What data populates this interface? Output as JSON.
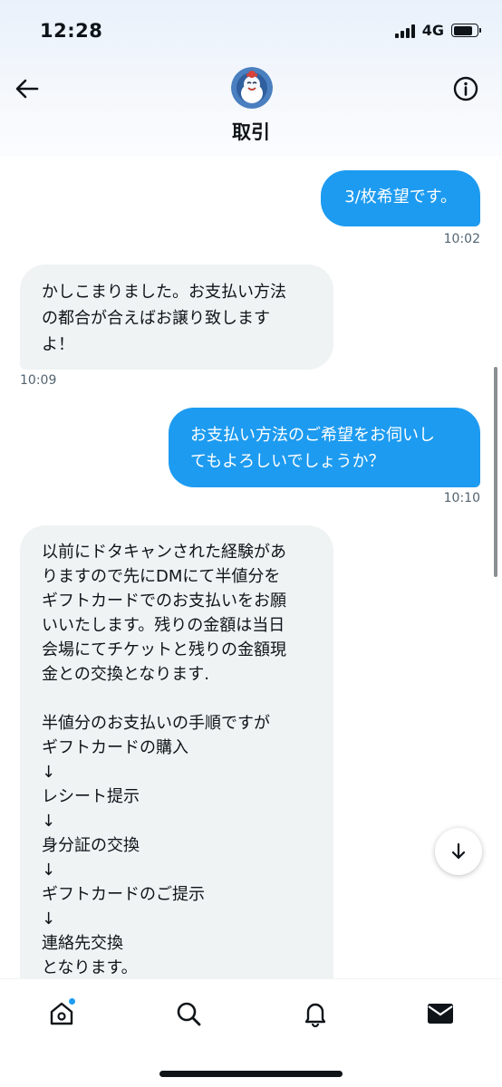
{
  "status_bar": {
    "time": "12:28",
    "network": "4G"
  },
  "header": {
    "title": "取引"
  },
  "icons": {
    "back": "arrow-left-icon",
    "info": "info-circle-icon",
    "scroll_down": "arrow-down-icon",
    "home": "home-icon",
    "search": "search-icon",
    "notifications": "bell-icon",
    "messages": "envelope-icon"
  },
  "messages": [
    {
      "direction": "out",
      "text": "3/枚希望です。",
      "time": "10:02"
    },
    {
      "direction": "in",
      "lines": [
        "かしこまりました。お支払い方法",
        "の都合が合えばお譲り致します",
        "よ！"
      ],
      "time": "10:09"
    },
    {
      "direction": "out",
      "lines": [
        "お支払い方法のご希望をお伺いし",
        "てもよろしいでしょうか？"
      ],
      "time": "10:10"
    },
    {
      "direction": "in",
      "lines": [
        "以前にドタキャンされた経験があ",
        "りますので先にDMにて半値分を",
        "ギフトカードでのお支払いをお願",
        "いいたします。残りの金額は当日",
        "会場にてチケットと残りの金額現",
        "金との交換となります.",
        "",
        "半値分のお支払いの手順ですが",
        "ギフトカードの購入",
        "↓",
        "レシート提示",
        "↓",
        "身分証の交換",
        "↓",
        "ギフトカードのご提示",
        "↓",
        "連絡先交換",
        "となります。"
      ]
    }
  ],
  "colors": {
    "accent": "#1d9bf0",
    "incoming_bubble": "#eff3f4",
    "text": "#0f1419",
    "muted": "#536471"
  }
}
